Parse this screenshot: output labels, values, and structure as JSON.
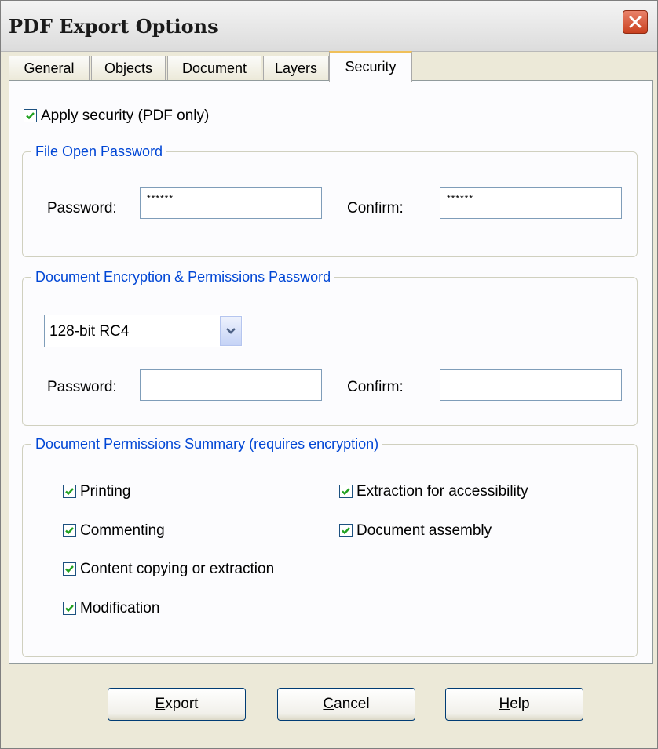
{
  "window": {
    "title": "PDF Export Options"
  },
  "tabs": [
    {
      "label": "General"
    },
    {
      "label": "Objects"
    },
    {
      "label": "Document"
    },
    {
      "label": "Layers"
    },
    {
      "label": "Security",
      "active": true
    }
  ],
  "security": {
    "apply_label": "Apply security (PDF only)",
    "apply_checked": true
  },
  "file_open": {
    "legend": "File Open Password",
    "password_label": "Password:",
    "password_value": "******",
    "confirm_label": "Confirm:",
    "confirm_value": "******"
  },
  "encryption": {
    "legend": "Document Encryption & Permissions Password",
    "method_selected": "128-bit RC4",
    "password_label": "Password:",
    "password_value": "",
    "confirm_label": "Confirm:",
    "confirm_value": ""
  },
  "permissions": {
    "legend": "Document Permissions Summary (requires encryption)",
    "items": [
      {
        "label": "Printing",
        "checked": true
      },
      {
        "label": "Commenting",
        "checked": true
      },
      {
        "label": "Content copying or extraction",
        "checked": true
      },
      {
        "label": "Modification",
        "checked": true
      },
      {
        "label": "Extraction for accessibility",
        "checked": true
      },
      {
        "label": "Document assembly",
        "checked": true
      }
    ]
  },
  "buttons": {
    "export_mnemonic": "E",
    "export_rest": "xport",
    "cancel_mnemonic": "C",
    "cancel_rest": "ancel",
    "help_mnemonic": "H",
    "help_rest": "elp"
  },
  "colors": {
    "accent_blue": "#0046d5",
    "check_green": "#21a121",
    "close_red": "#c9401f",
    "tab_highlight": "#f0c05a"
  },
  "icons": {
    "close": "close-icon",
    "check": "checkmark-icon",
    "dropdown": "chevron-down-icon"
  }
}
